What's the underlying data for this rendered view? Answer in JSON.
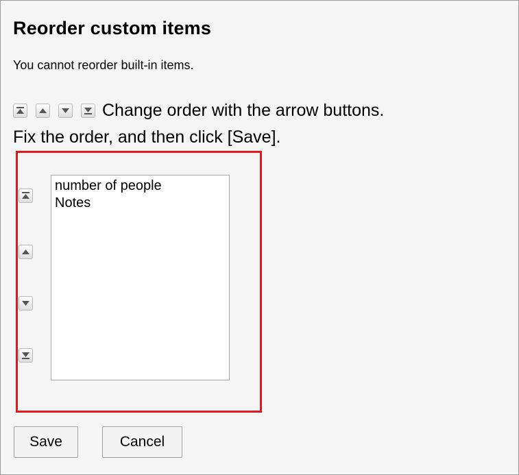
{
  "page": {
    "title": "Reorder custom items",
    "notice": "You cannot reorder built-in items.",
    "instruction_line1": "Change order with the arrow buttons.",
    "instruction_line2": "Fix the order, and then click [Save]."
  },
  "instruction_icons": [
    "move-to-top-icon",
    "move-up-icon",
    "move-down-icon",
    "move-to-bottom-icon"
  ],
  "listbox": {
    "items": [
      "number of people",
      "Notes"
    ]
  },
  "buttons": {
    "save_label": "Save",
    "cancel_label": "Cancel"
  },
  "colors": {
    "highlight_border": "#e01a1a",
    "frame_background": "#f5f5f5"
  }
}
